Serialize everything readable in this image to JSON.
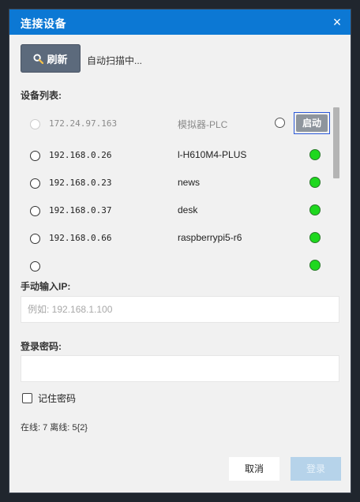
{
  "dialog": {
    "title": "连接设备",
    "close_symbol": "×"
  },
  "toolbar": {
    "refresh_label": "刷新",
    "refresh_icon": "search-icon",
    "scan_status": "自动扫描中..."
  },
  "device_list": {
    "label": "设备列表:",
    "start_label": "启动",
    "devices": [
      {
        "ip": "172.24.97.163",
        "name": "模拟器-PLC",
        "status": "offline"
      },
      {
        "ip": "192.168.0.26",
        "name": "l-H610M4-PLUS",
        "status": "online"
      },
      {
        "ip": "192.168.0.23",
        "name": "news",
        "status": "online"
      },
      {
        "ip": "192.168.0.37",
        "name": "desk",
        "status": "online"
      },
      {
        "ip": "192.168.0.66",
        "name": "raspberrypi5-r6",
        "status": "online"
      }
    ]
  },
  "manual_ip": {
    "label": "手动输入IP:",
    "placeholder": "例如: 192.168.1.100",
    "value": ""
  },
  "password": {
    "label": "登录密码:",
    "value": ""
  },
  "remember": {
    "label": "记住密码",
    "checked": false
  },
  "stats": "在线: 7 离线: 5{2}",
  "buttons": {
    "cancel": "取消",
    "login": "登录"
  },
  "colors": {
    "titlebar": "#0c78d4",
    "online_dot": "#1ed81e",
    "refresh_button": "#5c6a7c",
    "login_disabled": "#b6d3ea"
  }
}
